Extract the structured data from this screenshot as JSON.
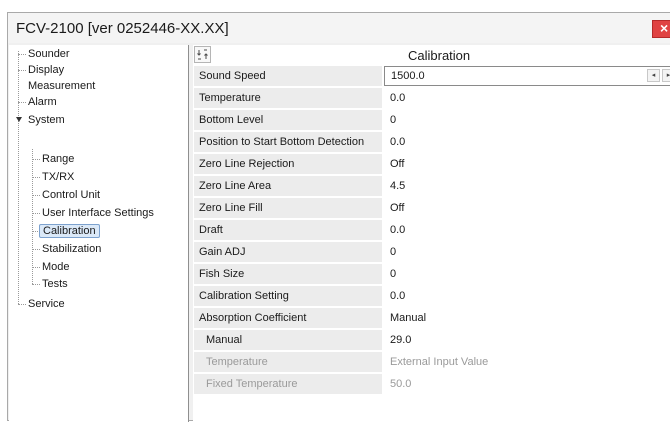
{
  "window": {
    "title": "FCV-2100 [ver 0252446-XX.XX]",
    "close_glyph": "×"
  },
  "tree": {
    "items": [
      {
        "label": "Sounder"
      },
      {
        "label": "Display"
      },
      {
        "label": "Measurement"
      },
      {
        "label": "Alarm"
      },
      {
        "label": "System"
      },
      {
        "label": "Range"
      },
      {
        "label": "TX/RX"
      },
      {
        "label": "Control Unit"
      },
      {
        "label": "User Interface Settings"
      },
      {
        "label": "Calibration"
      },
      {
        "label": "Stabilization"
      },
      {
        "label": "Mode"
      },
      {
        "label": "Tests"
      },
      {
        "label": "Service"
      }
    ],
    "selected": "Calibration",
    "expanded": "System"
  },
  "panel": {
    "title": "Calibration",
    "sort_icon": "sort-icon"
  },
  "rows": [
    {
      "name": "Sound Speed",
      "value": "1500.0"
    },
    {
      "name": "Temperature",
      "value": "0.0"
    },
    {
      "name": "Bottom Level",
      "value": "0"
    },
    {
      "name": "Position to Start Bottom Detection",
      "value": "0.0"
    },
    {
      "name": "Zero Line Rejection",
      "value": "Off"
    },
    {
      "name": "Zero Line Area",
      "value": "4.5"
    },
    {
      "name": "Zero Line Fill",
      "value": "Off"
    },
    {
      "name": "Draft",
      "value": "0.0"
    },
    {
      "name": "Gain ADJ",
      "value": "0"
    },
    {
      "name": "Fish Size",
      "value": "0"
    },
    {
      "name": "Calibration Setting",
      "value": "0.0"
    },
    {
      "name": "Absorption Coefficient",
      "value": "Manual"
    },
    {
      "name": "Manual",
      "value": "29.0"
    },
    {
      "name": "Temperature",
      "value": "External Input Value"
    },
    {
      "name": "Fixed Temperature",
      "value": "50.0"
    }
  ],
  "spinner": {
    "left_glyph": "◂",
    "right_glyph": "▸"
  },
  "colors": {
    "close_button": "#e04343",
    "selection": "#dbe9f8"
  }
}
